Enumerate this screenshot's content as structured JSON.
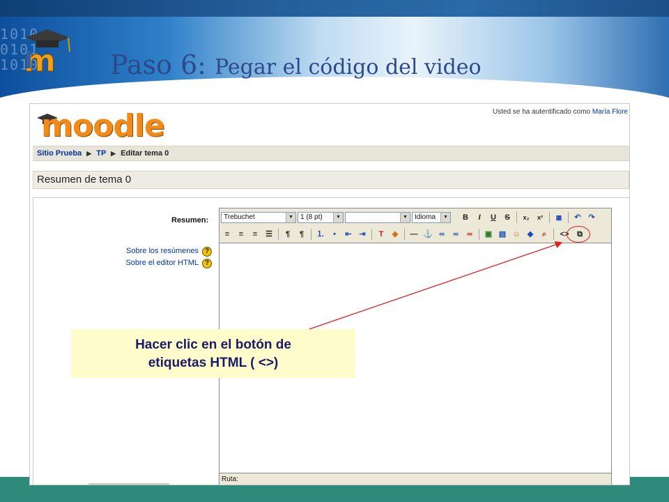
{
  "slide": {
    "title_lead": "Paso 6: ",
    "title_rest": "Pegar el código del video",
    "bg_digits": "1010\n0101\n1010",
    "colors": {
      "title": "#2c4a8a",
      "bottom_band": "#2f8a7c",
      "header_blue": "#2f80c9"
    }
  },
  "moodle": {
    "logo_text": "moodle",
    "login_prefix": "Usted se ha autentificado como ",
    "login_user": "María Flore",
    "breadcrumb": [
      {
        "label": "Sitio Prueba",
        "link": true
      },
      {
        "label": "TP",
        "link": true
      },
      {
        "label": "Editar tema 0",
        "link": false
      }
    ],
    "breadcrumb_sep": "▶",
    "section_title": "Resumen de tema 0",
    "form": {
      "field_label": "Resumen:",
      "help_links": [
        "Sobre los resúmenes",
        "Sobre el editor HTML"
      ],
      "help_icon": "?"
    },
    "editor": {
      "font_family": "Trebuchet",
      "font_size": "1 (8 pt)",
      "format": "",
      "language": "Idioma",
      "ruta_label": "Ruta:",
      "toolbar_row1_icons": [
        "bold-icon",
        "italic-icon",
        "underline-icon",
        "strikethrough-icon",
        "subscript-icon",
        "superscript-icon",
        "paste-word-icon",
        "undo-icon",
        "redo-icon"
      ],
      "toolbar_row2_icons": [
        "align-left-icon",
        "align-center-icon",
        "align-right-icon",
        "justify-icon",
        "ltr-icon",
        "rtl-icon",
        "ordered-list-icon",
        "unordered-list-icon",
        "outdent-icon",
        "indent-icon",
        "text-color-icon",
        "highlight-color-icon",
        "horizontal-rule-icon",
        "anchor-icon",
        "link-icon",
        "unlink-icon",
        "nolink-icon",
        "image-icon",
        "table-icon",
        "smiley-icon",
        "special-char-icon",
        "search-replace-icon",
        "html-source-icon",
        "fullscreen-icon"
      ],
      "html_button_label": "<>"
    }
  },
  "callout": {
    "line1": "Hacer clic en el botón de",
    "line2": "etiquetas HTML ( <>)",
    "arrow_color": "#e02020"
  }
}
